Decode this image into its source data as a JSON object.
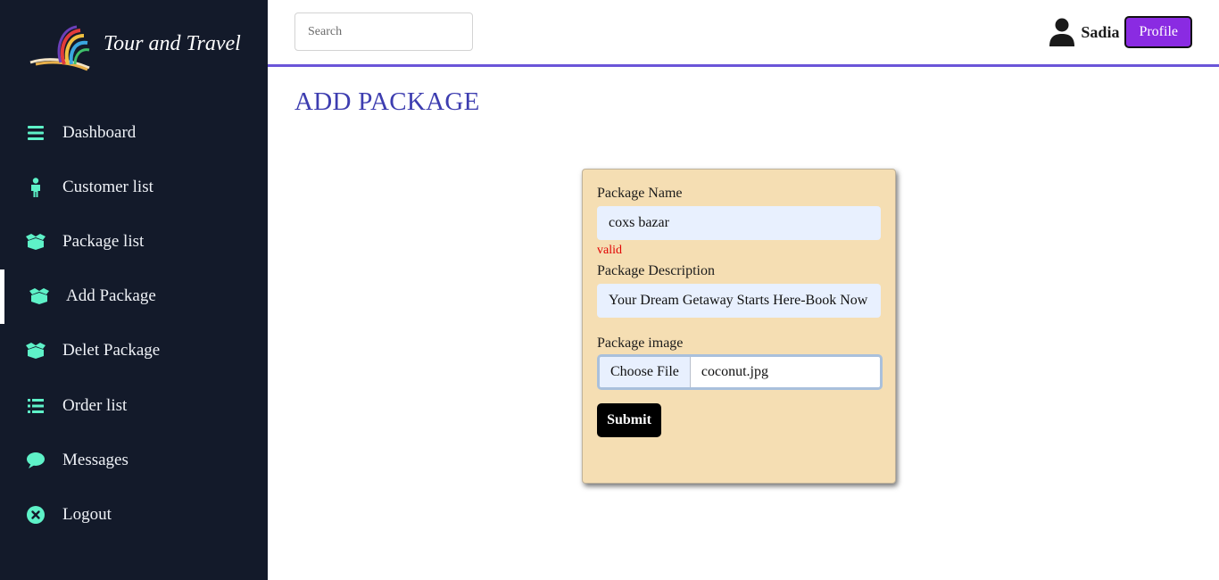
{
  "brand": {
    "title": "Tour and Travel",
    "logo": "swoosh-logo"
  },
  "sidebar": {
    "items": [
      {
        "label": "Dashboard",
        "icon": "bars-icon",
        "active": false
      },
      {
        "label": "Customer list",
        "icon": "person-icon",
        "active": false
      },
      {
        "label": "Package list",
        "icon": "box-open-icon",
        "active": false
      },
      {
        "label": "Add Package",
        "icon": "box-open-icon",
        "active": true
      },
      {
        "label": "Delet Package",
        "icon": "box-open-icon",
        "active": false
      },
      {
        "label": "Order list",
        "icon": "list-icon",
        "active": false
      },
      {
        "label": "Messages",
        "icon": "comment-icon",
        "active": false
      },
      {
        "label": "Logout",
        "icon": "circle-x-icon",
        "active": false
      }
    ],
    "icon_color": "#5ef2c8",
    "background": "#131a2a"
  },
  "header": {
    "search_placeholder": "Search",
    "user_name": "Sadia",
    "profile_label": "Profile",
    "accent": "#6a55d8"
  },
  "main": {
    "title": "ADD PACKAGE",
    "form": {
      "name_label": "Package Name",
      "name_value": "coxs bazar",
      "valid_text": "valid",
      "desc_label": "Package Description",
      "desc_value": "Your Dream Getaway Starts Here-Book Now",
      "image_label": "Package image",
      "choose_file_label": "Choose File",
      "file_name": "coconut.jpg",
      "submit_label": "Submit"
    }
  }
}
